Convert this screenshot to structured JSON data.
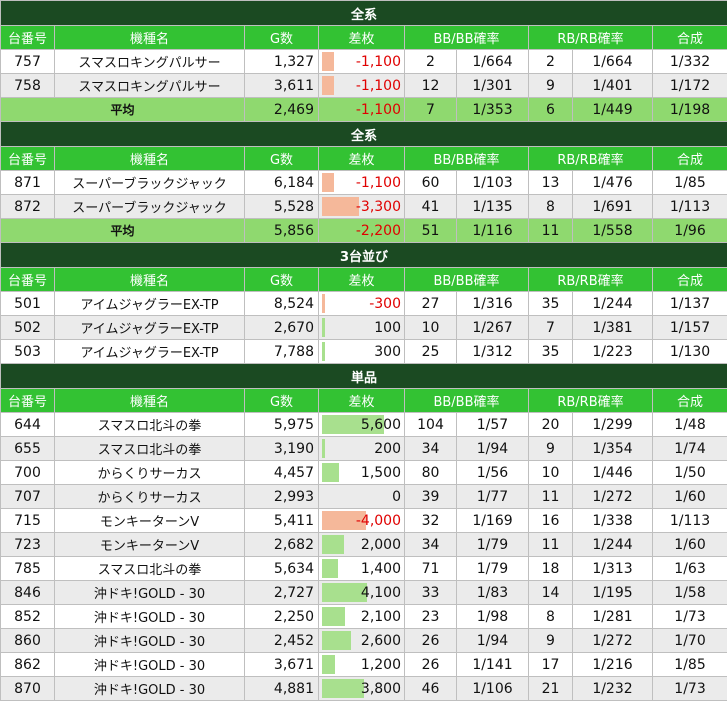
{
  "headers": [
    "台番号",
    "機種名",
    "G数",
    "差枚",
    "BB/BB確率",
    "RB/RB確率",
    "合成"
  ],
  "sections": [
    {
      "title": "全系",
      "rows": [
        {
          "no": "757",
          "name": "スマスロキングパルサー",
          "g": "1,327",
          "diff": "-1,100",
          "diff_val": -1100,
          "bb": "2",
          "bbp": "1/664",
          "rb": "2",
          "rbp": "1/664",
          "total": "1/332"
        },
        {
          "no": "758",
          "name": "スマスロキングパルサー",
          "g": "3,611",
          "diff": "-1,100",
          "diff_val": -1100,
          "bb": "12",
          "bbp": "1/301",
          "rb": "9",
          "rbp": "1/401",
          "total": "1/172"
        }
      ],
      "avg": {
        "label": "平均",
        "g": "2,469",
        "diff": "-1,100",
        "bb": "7",
        "bbp": "1/353",
        "rb": "6",
        "rbp": "1/449",
        "total": "1/198"
      }
    },
    {
      "title": "全系",
      "rows": [
        {
          "no": "871",
          "name": "スーパーブラックジャック",
          "g": "6,184",
          "diff": "-1,100",
          "diff_val": -1100,
          "bb": "60",
          "bbp": "1/103",
          "rb": "13",
          "rbp": "1/476",
          "total": "1/85"
        },
        {
          "no": "872",
          "name": "スーパーブラックジャック",
          "g": "5,528",
          "diff": "-3,300",
          "diff_val": -3300,
          "bb": "41",
          "bbp": "1/135",
          "rb": "8",
          "rbp": "1/691",
          "total": "1/113"
        }
      ],
      "avg": {
        "label": "平均",
        "g": "5,856",
        "diff": "-2,200",
        "bb": "51",
        "bbp": "1/116",
        "rb": "11",
        "rbp": "1/558",
        "total": "1/96"
      }
    },
    {
      "title": "3台並び",
      "rows": [
        {
          "no": "501",
          "name": "アイムジャグラーEX-TP",
          "g": "8,524",
          "diff": "-300",
          "diff_val": -300,
          "bb": "27",
          "bbp": "1/316",
          "rb": "35",
          "rbp": "1/244",
          "total": "1/137"
        },
        {
          "no": "502",
          "name": "アイムジャグラーEX-TP",
          "g": "2,670",
          "diff": "100",
          "diff_val": 100,
          "bb": "10",
          "bbp": "1/267",
          "rb": "7",
          "rbp": "1/381",
          "total": "1/157"
        },
        {
          "no": "503",
          "name": "アイムジャグラーEX-TP",
          "g": "7,788",
          "diff": "300",
          "diff_val": 300,
          "bb": "25",
          "bbp": "1/312",
          "rb": "35",
          "rbp": "1/223",
          "total": "1/130"
        }
      ]
    },
    {
      "title": "単品",
      "rows": [
        {
          "no": "644",
          "name": "スマスロ北斗の拳",
          "g": "5,975",
          "diff": "5,600",
          "diff_val": 5600,
          "bb": "104",
          "bbp": "1/57",
          "rb": "20",
          "rbp": "1/299",
          "total": "1/48"
        },
        {
          "no": "655",
          "name": "スマスロ北斗の拳",
          "g": "3,190",
          "diff": "200",
          "diff_val": 200,
          "bb": "34",
          "bbp": "1/94",
          "rb": "9",
          "rbp": "1/354",
          "total": "1/74"
        },
        {
          "no": "700",
          "name": "からくりサーカス",
          "g": "4,457",
          "diff": "1,500",
          "diff_val": 1500,
          "bb": "80",
          "bbp": "1/56",
          "rb": "10",
          "rbp": "1/446",
          "total": "1/50"
        },
        {
          "no": "707",
          "name": "からくりサーカス",
          "g": "2,993",
          "diff": "0",
          "diff_val": 0,
          "bb": "39",
          "bbp": "1/77",
          "rb": "11",
          "rbp": "1/272",
          "total": "1/60"
        },
        {
          "no": "715",
          "name": "モンキーターンV",
          "g": "5,411",
          "diff": "-4,000",
          "diff_val": -4000,
          "bb": "32",
          "bbp": "1/169",
          "rb": "16",
          "rbp": "1/338",
          "total": "1/113"
        },
        {
          "no": "723",
          "name": "モンキーターンV",
          "g": "2,682",
          "diff": "2,000",
          "diff_val": 2000,
          "bb": "34",
          "bbp": "1/79",
          "rb": "11",
          "rbp": "1/244",
          "total": "1/60"
        },
        {
          "no": "785",
          "name": "スマスロ北斗の拳",
          "g": "5,634",
          "diff": "1,400",
          "diff_val": 1400,
          "bb": "71",
          "bbp": "1/79",
          "rb": "18",
          "rbp": "1/313",
          "total": "1/63"
        },
        {
          "no": "846",
          "name": "沖ドキ!GOLD - 30",
          "g": "2,727",
          "diff": "4,100",
          "diff_val": 4100,
          "bb": "33",
          "bbp": "1/83",
          "rb": "14",
          "rbp": "1/195",
          "total": "1/58"
        },
        {
          "no": "852",
          "name": "沖ドキ!GOLD - 30",
          "g": "2,250",
          "diff": "2,100",
          "diff_val": 2100,
          "bb": "23",
          "bbp": "1/98",
          "rb": "8",
          "rbp": "1/281",
          "total": "1/73"
        },
        {
          "no": "860",
          "name": "沖ドキ!GOLD - 30",
          "g": "2,452",
          "diff": "2,600",
          "diff_val": 2600,
          "bb": "26",
          "bbp": "1/94",
          "rb": "9",
          "rbp": "1/272",
          "total": "1/70"
        },
        {
          "no": "862",
          "name": "沖ドキ!GOLD - 30",
          "g": "3,671",
          "diff": "1,200",
          "diff_val": 1200,
          "bb": "26",
          "bbp": "1/141",
          "rb": "17",
          "rbp": "1/216",
          "total": "1/85"
        },
        {
          "no": "870",
          "name": "沖ドキ!GOLD - 30",
          "g": "4,881",
          "diff": "3,800",
          "diff_val": 3800,
          "bb": "46",
          "bbp": "1/106",
          "rb": "21",
          "rbp": "1/232",
          "total": "1/73"
        }
      ]
    }
  ],
  "colors": {
    "band": "#1b4a22",
    "header": "#33c233",
    "avg": "#8fd96f",
    "pos_bar": "#a8e08e",
    "neg_bar": "#f5b89a",
    "neg_text": "#e00000"
  }
}
